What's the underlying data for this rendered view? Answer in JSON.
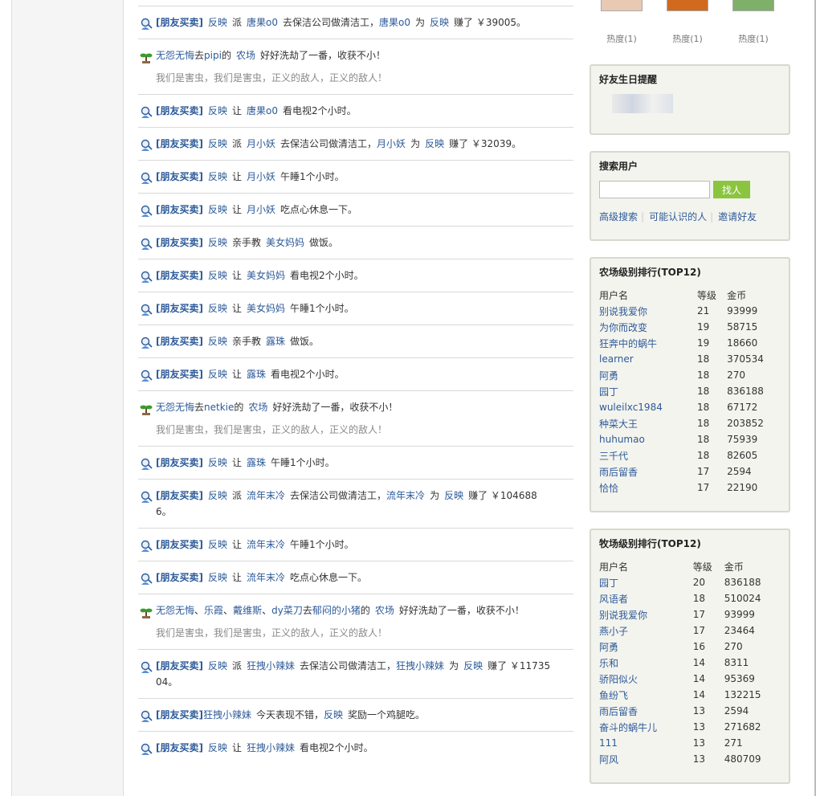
{
  "feed": [
    {
      "type": "trade",
      "parts": [
        "[朋友买卖]",
        "反映",
        "派",
        "唐果o0",
        "去保洁公司做清洁工，",
        "唐果o0",
        "为",
        "反映",
        "赚了 ￥39005。"
      ]
    },
    {
      "type": "farm",
      "parts": [
        "无怨无悔",
        "去",
        "pipi",
        "的",
        "农场",
        "好好洗劫了一番，收获不小！"
      ],
      "sub": "我们是害虫，我们是害虫，正义的敌人，正义的敌人！"
    },
    {
      "type": "trade",
      "parts": [
        "[朋友买卖]",
        "反映",
        "让",
        "唐果o0",
        "看电视2个小时。"
      ]
    },
    {
      "type": "trade",
      "parts": [
        "[朋友买卖]",
        "反映",
        "派",
        "月小妖",
        "去保洁公司做清洁工，",
        "月小妖",
        "为",
        "反映",
        "赚了 ￥32039。"
      ]
    },
    {
      "type": "trade",
      "parts": [
        "[朋友买卖]",
        "反映",
        "让",
        "月小妖",
        "午睡1个小时。"
      ]
    },
    {
      "type": "trade",
      "parts": [
        "[朋友买卖]",
        "反映",
        "让",
        "月小妖",
        "吃点心休息一下。"
      ]
    },
    {
      "type": "trade",
      "parts": [
        "[朋友买卖]",
        "反映",
        "亲手教",
        "美女妈妈",
        "做饭。"
      ]
    },
    {
      "type": "trade",
      "parts": [
        "[朋友买卖]",
        "反映",
        "让",
        "美女妈妈",
        "看电视2个小时。"
      ]
    },
    {
      "type": "trade",
      "parts": [
        "[朋友买卖]",
        "反映",
        "让",
        "美女妈妈",
        "午睡1个小时。"
      ]
    },
    {
      "type": "trade",
      "parts": [
        "[朋友买卖]",
        "反映",
        "亲手教",
        "露珠",
        "做饭。"
      ]
    },
    {
      "type": "trade",
      "parts": [
        "[朋友买卖]",
        "反映",
        "让",
        "露珠",
        "看电视2个小时。"
      ]
    },
    {
      "type": "farm",
      "parts": [
        "无怨无悔",
        "去",
        "netkie",
        "的",
        "农场",
        "好好洗劫了一番，收获不小！"
      ],
      "sub": "我们是害虫，我们是害虫，正义的敌人，正义的敌人！"
    },
    {
      "type": "trade",
      "parts": [
        "[朋友买卖]",
        "反映",
        "让",
        "露珠",
        "午睡1个小时。"
      ]
    },
    {
      "type": "trade",
      "parts": [
        "[朋友买卖]",
        "反映",
        "派",
        "流年末冷",
        "去保洁公司做清洁工，",
        "流年末冷",
        "为",
        "反映",
        "赚了 ￥104688",
        "6。"
      ]
    },
    {
      "type": "trade",
      "parts": [
        "[朋友买卖]",
        "反映",
        "让",
        "流年末冷",
        "午睡1个小时。"
      ]
    },
    {
      "type": "trade",
      "parts": [
        "[朋友买卖]",
        "反映",
        "让",
        "流年末冷",
        "吃点心休息一下。"
      ]
    },
    {
      "type": "farm3",
      "parts": [
        "无怨无悔",
        "、",
        "乐霞",
        "、",
        "戴维斯",
        "、",
        "dy菜刀",
        "去",
        "郁闷的小猪",
        "的",
        "农场",
        "好好洗劫了一番，收获不小！"
      ],
      "sub": "我们是害虫，我们是害虫，正义的敌人，正义的敌人！"
    },
    {
      "type": "trade",
      "parts": [
        "[朋友买卖]",
        "反映",
        "派",
        "狂拽小辣妹",
        "去保洁公司做清洁工，",
        "狂拽小辣妹",
        "为",
        "反映",
        "赚了 ￥11735",
        "04。"
      ]
    },
    {
      "type": "reward",
      "parts": [
        "[朋友买卖]",
        "狂拽小辣妹",
        "今天表现不错，",
        "反映",
        "奖励一个鸡腿吃。"
      ]
    },
    {
      "type": "trade",
      "parts": [
        "[朋友买卖]",
        "反映",
        "让",
        "狂拽小辣妹",
        "看电视2个小时。"
      ]
    }
  ],
  "thumbs": [
    "热度(1)",
    "热度(1)",
    "热度(1)"
  ],
  "birthday": {
    "title": "好友生日提醒"
  },
  "search": {
    "title": "搜索用户",
    "button": "找人",
    "placeholder": "",
    "links": [
      "高级搜索",
      "可能认识的人",
      "邀请好友"
    ]
  },
  "farm_rank": {
    "title": "农场级别排行(TOP12)",
    "headers": [
      "用户名",
      "等级",
      "金币"
    ],
    "rows": [
      [
        "别说我爱你",
        "21",
        "93999"
      ],
      [
        "为你而改变",
        "19",
        "58715"
      ],
      [
        "狂奔中的蜗牛",
        "19",
        "18660"
      ],
      [
        "learner",
        "18",
        "370534"
      ],
      [
        "阿勇",
        "18",
        "270"
      ],
      [
        "园丁",
        "18",
        "836188"
      ],
      [
        "wuleilxc1984",
        "18",
        "67172"
      ],
      [
        "种菜大王",
        "18",
        "203852"
      ],
      [
        "huhumao",
        "18",
        "75939"
      ],
      [
        "三千代",
        "18",
        "82605"
      ],
      [
        "雨后留香",
        "17",
        "2594"
      ],
      [
        "恰恰",
        "17",
        "22190"
      ]
    ]
  },
  "ranch_rank": {
    "title": "牧场级别排行(TOP12)",
    "headers": [
      "用户名",
      "等级",
      "金币"
    ],
    "rows": [
      [
        "园丁",
        "20",
        "836188"
      ],
      [
        "风语者",
        "18",
        "510024"
      ],
      [
        "别说我爱你",
        "17",
        "93999"
      ],
      [
        "燕小子",
        "17",
        "23464"
      ],
      [
        "阿勇",
        "16",
        "270"
      ],
      [
        "乐和",
        "14",
        "8311"
      ],
      [
        "骄阳似火",
        "14",
        "95369"
      ],
      [
        "鱼纷飞",
        "14",
        "132215"
      ],
      [
        "雨后留香",
        "13",
        "2594"
      ],
      [
        "奋斗的蜗牛儿",
        "13",
        "271682"
      ],
      [
        "111",
        "13",
        "271"
      ],
      [
        "阿风",
        "13",
        "480709"
      ]
    ]
  }
}
